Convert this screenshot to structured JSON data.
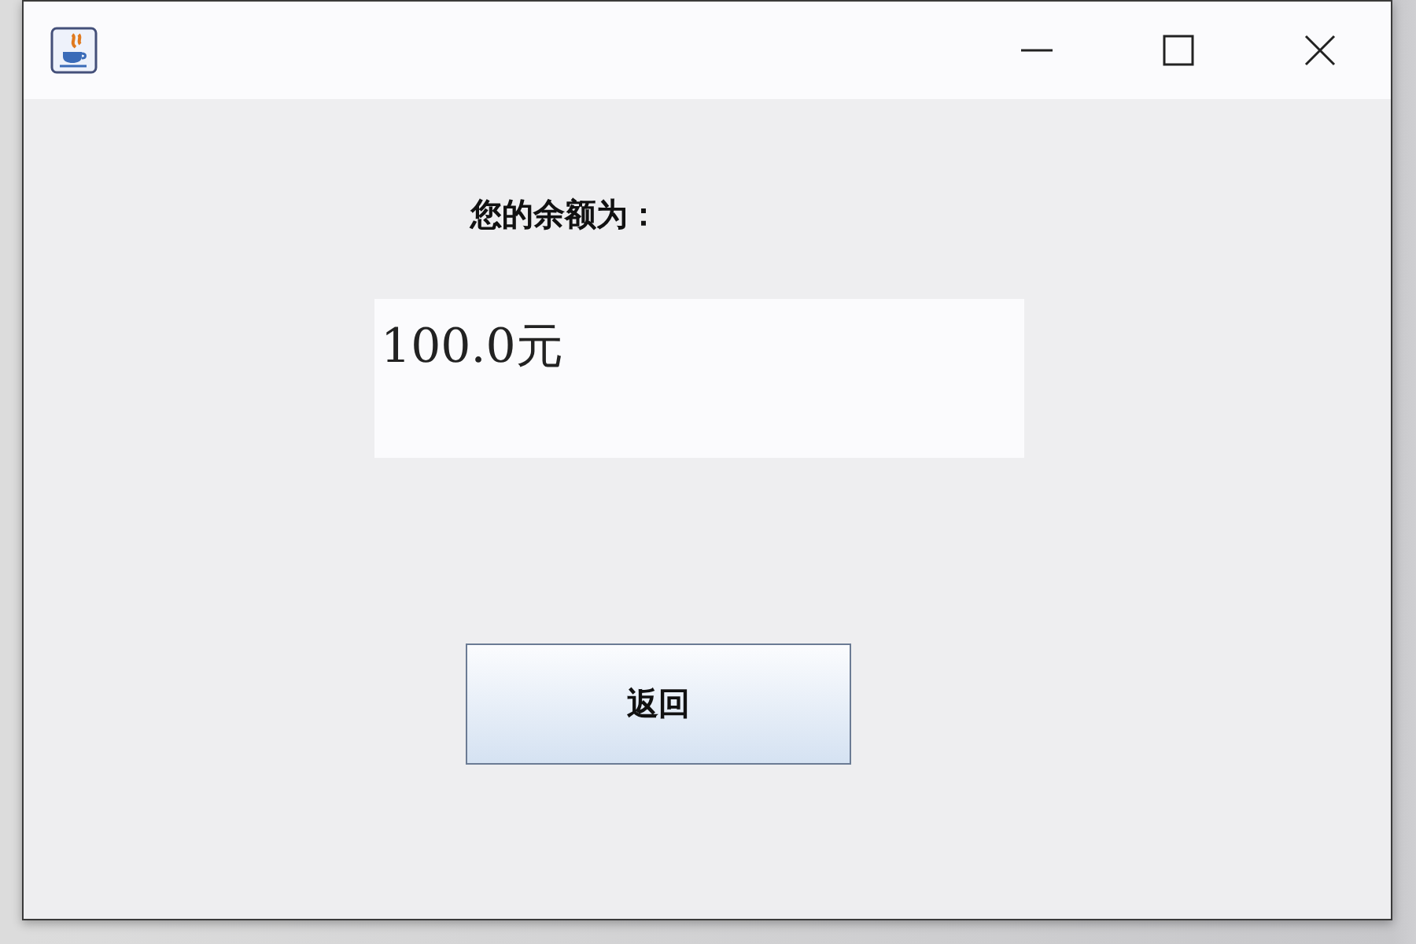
{
  "balance_label": "您的余额为：",
  "balance_field": {
    "value": "100.0元"
  },
  "buttons": [
    {
      "label": "返回"
    }
  ]
}
